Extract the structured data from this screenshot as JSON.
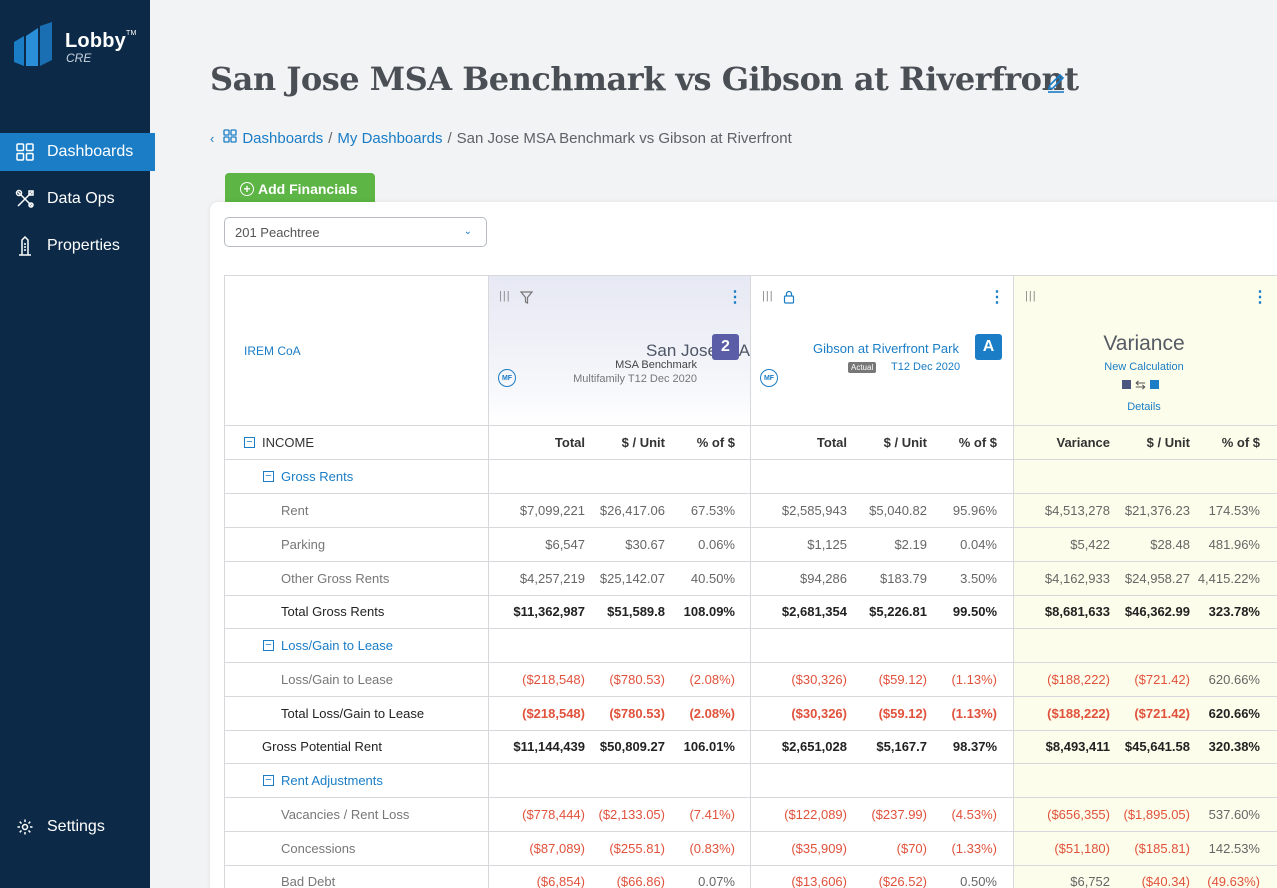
{
  "app": {
    "logo_name": "Lobby",
    "logo_tm": "TM",
    "logo_sub": "CRE"
  },
  "sidebar": {
    "items": [
      {
        "label": "Dashboards",
        "icon": "dashboard-grid-icon",
        "active": true
      },
      {
        "label": "Data Ops",
        "icon": "tools-icon",
        "active": false
      },
      {
        "label": "Properties",
        "icon": "building-icon",
        "active": false
      }
    ],
    "settings_label": "Settings"
  },
  "header": {
    "title": "San Jose MSA Benchmark vs Gibson at Riverfront",
    "breadcrumb": {
      "crumb1": "Dashboards",
      "crumb2": "My Dashboards",
      "current": "San Jose MSA Benchmark vs Gibson at Riverfront",
      "sep": "/"
    }
  },
  "toolbar": {
    "add_financials": "Add Financials"
  },
  "property_select": {
    "value": "201 Peachtree"
  },
  "grid": {
    "coa_label": "IREM CoA",
    "col1": {
      "city": "San Jose, CA",
      "sub": "MSA Benchmark",
      "meta": "Multifamily T12 Dec 2020",
      "badge": "2",
      "type_badge": "MF"
    },
    "col2": {
      "name": "Gibson at Riverfront Park",
      "tag": "Actual",
      "period": "T12 Dec 2020",
      "badge": "A",
      "type_badge": "MF"
    },
    "col3": {
      "title": "Variance",
      "sub": "New Calculation",
      "details": "Details"
    },
    "col_headers": {
      "c1": [
        "Total",
        "$ / Unit",
        "% of $"
      ],
      "c2": [
        "Total",
        "$ / Unit",
        "% of $"
      ],
      "c3": [
        "Variance",
        "$ / Unit",
        "% of $"
      ]
    },
    "rows": [
      {
        "label": "INCOME",
        "kind": "top",
        "values": []
      },
      {
        "label": "Gross Rents",
        "kind": "section",
        "values": []
      },
      {
        "label": "Rent",
        "kind": "item",
        "values": [
          "$7,099,221",
          "$26,417.06",
          "67.53%",
          "$2,585,943",
          "$5,040.82",
          "95.96%",
          "$4,513,278",
          "$21,376.23",
          "174.53%"
        ]
      },
      {
        "label": "Parking",
        "kind": "item",
        "values": [
          "$6,547",
          "$30.67",
          "0.06%",
          "$1,125",
          "$2.19",
          "0.04%",
          "$5,422",
          "$28.48",
          "481.96%"
        ]
      },
      {
        "label": "Other Gross Rents",
        "kind": "item",
        "values": [
          "$4,257,219",
          "$25,142.07",
          "40.50%",
          "$94,286",
          "$183.79",
          "3.50%",
          "$4,162,933",
          "$24,958.27",
          "4,415.22%"
        ]
      },
      {
        "label": "Total Gross Rents",
        "kind": "total",
        "values": [
          "$11,362,987",
          "$51,589.8",
          "108.09%",
          "$2,681,354",
          "$5,226.81",
          "99.50%",
          "$8,681,633",
          "$46,362.99",
          "323.78%"
        ]
      },
      {
        "label": "Loss/Gain to Lease",
        "kind": "section",
        "values": []
      },
      {
        "label": "Loss/Gain to Lease",
        "kind": "item",
        "values": [
          "($218,548)",
          "($780.53)",
          "(2.08%)",
          "($30,326)",
          "($59.12)",
          "(1.13%)",
          "($188,222)",
          "($721.42)",
          "620.66%"
        ]
      },
      {
        "label": "Total Loss/Gain to Lease",
        "kind": "total",
        "values": [
          "($218,548)",
          "($780.53)",
          "(2.08%)",
          "($30,326)",
          "($59.12)",
          "(1.13%)",
          "($188,222)",
          "($721.42)",
          "620.66%"
        ]
      },
      {
        "label": "Gross Potential Rent",
        "kind": "grand",
        "values": [
          "$11,144,439",
          "$50,809.27",
          "106.01%",
          "$2,651,028",
          "$5,167.7",
          "98.37%",
          "$8,493,411",
          "$45,641.58",
          "320.38%"
        ]
      },
      {
        "label": "Rent Adjustments",
        "kind": "section",
        "values": []
      },
      {
        "label": "Vacancies / Rent Loss",
        "kind": "item",
        "values": [
          "($778,444)",
          "($2,133.05)",
          "(7.41%)",
          "($122,089)",
          "($237.99)",
          "(4.53%)",
          "($656,355)",
          "($1,895.05)",
          "537.60%"
        ]
      },
      {
        "label": "Concessions",
        "kind": "item",
        "values": [
          "($87,089)",
          "($255.81)",
          "(0.83%)",
          "($35,909)",
          "($70)",
          "(1.33%)",
          "($51,180)",
          "($185.81)",
          "142.53%"
        ]
      },
      {
        "label": "Bad Debt",
        "kind": "item",
        "values": [
          "($6,854)",
          "($66.86)",
          "0.07%",
          "($13,606)",
          "($26.52)",
          "0.50%",
          "$6,752",
          "($40.34)",
          "(49.63%)"
        ]
      }
    ]
  },
  "colors": {
    "sidebar_bg": "#0c2a47",
    "accent": "#1a7dc6",
    "add_button": "#5cb544",
    "negative": "#e0523c",
    "variance_bg": "#fdfdeb"
  }
}
